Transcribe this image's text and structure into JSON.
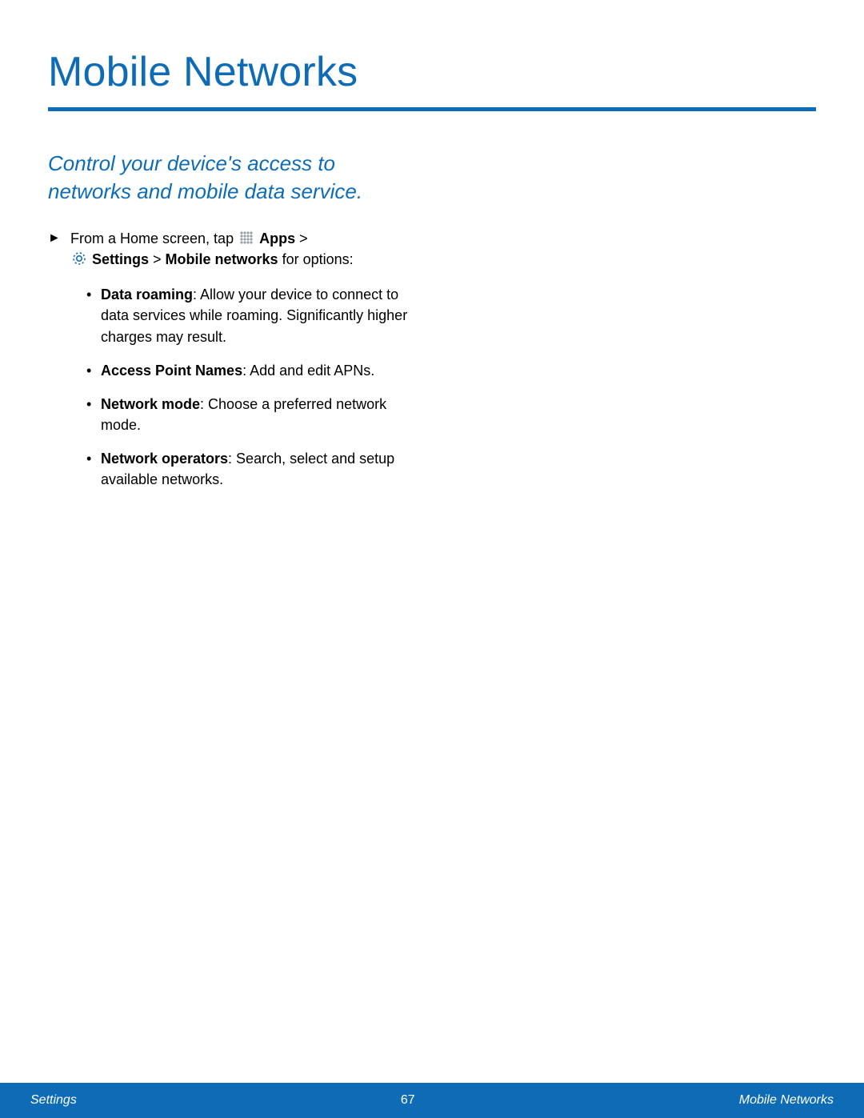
{
  "title": "Mobile Networks",
  "intro": "Control your device's access to networks and mobile data service.",
  "step": {
    "prefix": "From a Home screen, tap ",
    "apps": "Apps",
    "gt1": " > ",
    "settings": "Settings",
    "mid": " > ",
    "mobile": "Mobile networks",
    "suffix": " for options:"
  },
  "options": [
    {
      "name": "Data roaming",
      "desc": ": Allow your device to connect to data services while roaming. Significantly higher charges may result."
    },
    {
      "name": "Access Point Names",
      "desc": ": Add and edit APNs."
    },
    {
      "name": "Network mode",
      "desc": ": Choose a preferred network mode."
    },
    {
      "name": "Network operators",
      "desc": ": Search, select and setup available networks."
    }
  ],
  "footer": {
    "left": "Settings",
    "page": "67",
    "right": "Mobile Networks"
  }
}
